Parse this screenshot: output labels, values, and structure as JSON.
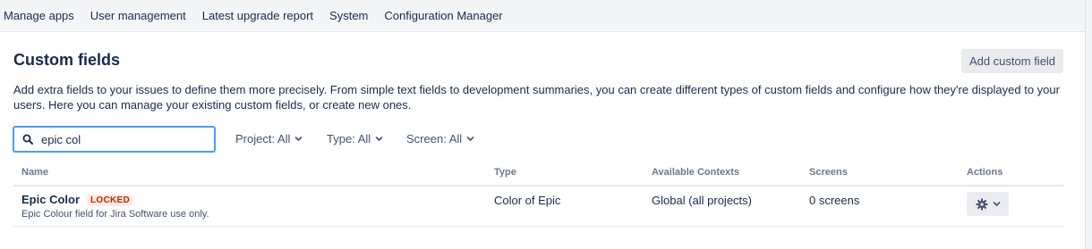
{
  "topnav": {
    "items": [
      "Manage apps",
      "User management",
      "Latest upgrade report",
      "System",
      "Configuration Manager"
    ]
  },
  "header": {
    "title": "Custom fields",
    "add_button": "Add custom field",
    "description": "Add extra fields to your issues to define them more precisely. From simple text fields to development summaries, you can create different types of custom fields and configure how they're displayed to your users. Here you can manage your existing custom fields, or create new ones."
  },
  "search": {
    "value": "epic col",
    "icon": "search-icon"
  },
  "filters": {
    "project": "Project: All",
    "type": "Type: All",
    "screen": "Screen: All"
  },
  "table": {
    "columns": [
      "Name",
      "Type",
      "Available Contexts",
      "Screens",
      "Actions"
    ],
    "rows": [
      {
        "name": "Epic Color",
        "badge": "LOCKED",
        "description": "Epic Colour field for Jira Software use only.",
        "type": "Color of Epic",
        "contexts": "Global (all projects)",
        "screens": "0 screens"
      }
    ]
  },
  "colors": {
    "focus_border": "#4c9aff",
    "locked_bg": "#ffebe6",
    "locked_text": "#bf2600",
    "text": "#172b4d"
  }
}
